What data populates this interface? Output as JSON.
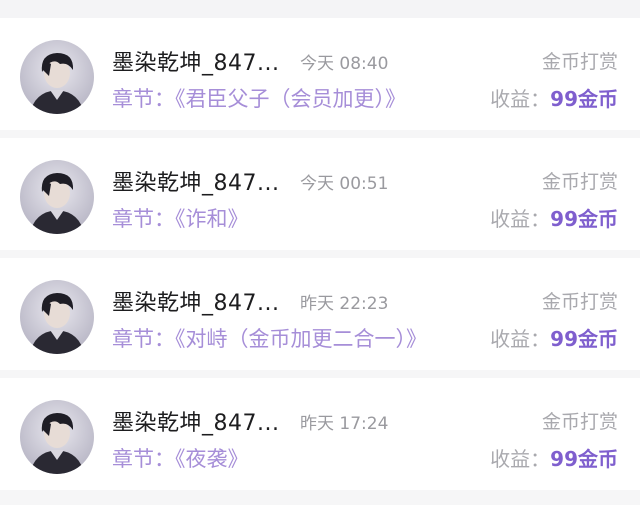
{
  "tips": [
    {
      "name": "墨染乾坤_847...",
      "time": "今天 08:40",
      "type": "金币打赏",
      "chapter_label": "章节：",
      "chapter": "《君臣父子（会员加更）》",
      "earn_label": "收益：",
      "earn_value": "99金币",
      "avatar_icon": "user-avatar-icon"
    },
    {
      "name": "墨染乾坤_847...",
      "time": "今天 00:51",
      "type": "金币打赏",
      "chapter_label": "章节：",
      "chapter": "《诈和》",
      "earn_label": "收益：",
      "earn_value": "99金币",
      "avatar_icon": "user-avatar-icon"
    },
    {
      "name": "墨染乾坤_847...",
      "time": "昨天 22:23",
      "type": "金币打赏",
      "chapter_label": "章节：",
      "chapter": "《对峙（金币加更二合一）》",
      "earn_label": "收益：",
      "earn_value": "99金币",
      "avatar_icon": "user-avatar-icon"
    },
    {
      "name": "墨染乾坤_847...",
      "time": "昨天 17:24",
      "type": "金币打赏",
      "chapter_label": "章节：",
      "chapter": "《夜袭》",
      "earn_label": "收益：",
      "earn_value": "99金币",
      "avatar_icon": "user-avatar-icon"
    }
  ],
  "colors": {
    "chapter": "#a68ed8",
    "earn_value": "#7f5fce",
    "muted": "#a9a9ae"
  }
}
